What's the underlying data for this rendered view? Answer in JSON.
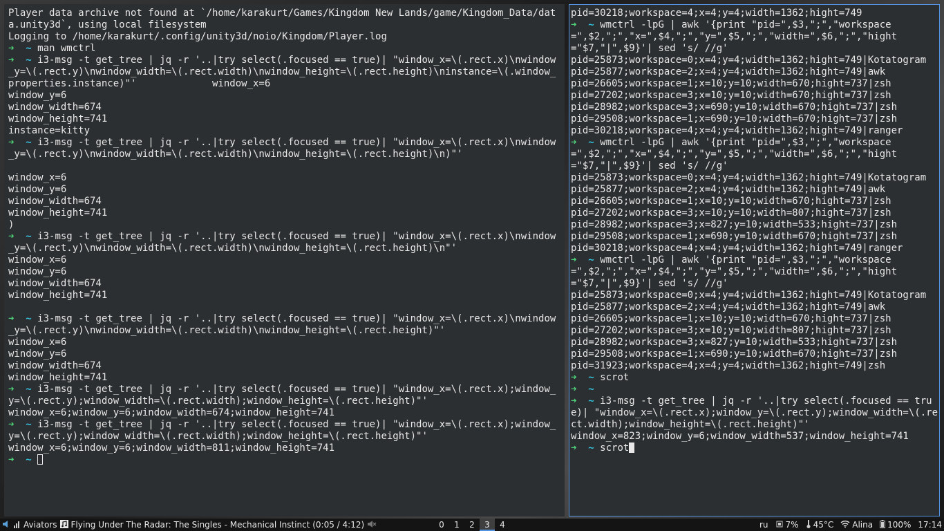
{
  "left_terminal": {
    "lines": [
      {
        "t": "Player data archive not found at `/home/karakurt/Games/Kingdom New Lands/game/Kingdom_Data/data.unity3d`, using local filesystem"
      },
      {
        "t": "Logging to /home/karakurt/.config/unity3d/noio/Kingdom/Player.log"
      },
      {
        "prompt": true,
        "t": "man wmctrl"
      },
      {
        "prompt": true,
        "t": "i3-msg -t get_tree | jq -r '..|try select(.focused == true)| \"window_x=\\(.rect.x)\\nwindow_y=\\(.rect.y)\\nwindow_width=\\(.rect.width)\\nwindow_height=\\(.rect.height)\\ninstance=\\(.window_properties.instance)\"'             window_x=6"
      },
      {
        "t": "window_y=6"
      },
      {
        "t": "window_width=674"
      },
      {
        "t": "window_height=741"
      },
      {
        "t": "instance=kitty"
      },
      {
        "prompt": true,
        "t": "i3-msg -t get_tree | jq -r '..|try select(.focused == true)| \"window_x=\\(.rect.x)\\nwindow_y=\\(.rect.y)\\nwindow_width=\\(.rect.width)\\nwindow_height=\\(.rect.height)\\n)\"'"
      },
      {
        "t": ""
      },
      {
        "t": "window_x=6"
      },
      {
        "t": "window_y=6"
      },
      {
        "t": "window_width=674"
      },
      {
        "t": "window_height=741"
      },
      {
        "t": ")"
      },
      {
        "prompt": true,
        "t": "i3-msg -t get_tree | jq -r '..|try select(.focused == true)| \"window_x=\\(.rect.x)\\nwindow_y=\\(.rect.y)\\nwindow_width=\\(.rect.width)\\nwindow_height=\\(.rect.height)\\n\"'"
      },
      {
        "t": "window_x=6"
      },
      {
        "t": "window_y=6"
      },
      {
        "t": "window_width=674"
      },
      {
        "t": "window_height=741"
      },
      {
        "t": ""
      },
      {
        "prompt": true,
        "t": "i3-msg -t get_tree | jq -r '..|try select(.focused == true)| \"window_x=\\(.rect.x)\\nwindow_y=\\(.rect.y)\\nwindow_width=\\(.rect.width)\\nwindow_height=\\(.rect.height)\"'"
      },
      {
        "t": "window_x=6"
      },
      {
        "t": "window_y=6"
      },
      {
        "t": "window_width=674"
      },
      {
        "t": "window_height=741"
      },
      {
        "prompt": true,
        "t": "i3-msg -t get_tree | jq -r '..|try select(.focused == true)| \"window_x=\\(.rect.x);window_y=\\(.rect.y);window_width=\\(.rect.width);window_height=\\(.rect.height)\"'"
      },
      {
        "t": "window_x=6;window_y=6;window_width=674;window_height=741"
      },
      {
        "prompt": true,
        "t": "i3-msg -t get_tree | jq -r '..|try select(.focused == true)| \"window_x=\\(.rect.x);window_y=\\(.rect.y);window_width=\\(.rect.width);window_height=\\(.rect.height)\"'"
      },
      {
        "t": "window_x=6;window_y=6;window_width=811;window_height=741"
      },
      {
        "prompt": true,
        "t": "",
        "cursor": "hollow"
      }
    ]
  },
  "right_terminal": {
    "lines": [
      {
        "t": "pid=30218;workspace=4;x=4;y=4;width=1362;hight=749"
      },
      {
        "prompt": true,
        "t": "wmctrl -lpG | awk '{print \"pid=\",$3,\";\",\"workspace=\",$2,\";\",\"x=\",$4,\";\",\"y=\",$5,\";\",\"width=\",$6,\";\",\"hight=\"$7,\"|\",$9}'| sed 's/ //g'"
      },
      {
        "t": "pid=25873;workspace=0;x=4;y=4;width=1362;hight=749|Kotatogram"
      },
      {
        "t": "pid=25877;workspace=2;x=4;y=4;width=1362;hight=749|awk"
      },
      {
        "t": "pid=26605;workspace=1;x=10;y=10;width=670;hight=737|zsh"
      },
      {
        "t": "pid=27202;workspace=3;x=10;y=10;width=670;hight=737|zsh"
      },
      {
        "t": "pid=28982;workspace=3;x=690;y=10;width=670;hight=737|zsh"
      },
      {
        "t": "pid=29508;workspace=1;x=690;y=10;width=670;hight=737|zsh"
      },
      {
        "t": "pid=30218;workspace=4;x=4;y=4;width=1362;hight=749|ranger"
      },
      {
        "prompt": true,
        "t": "wmctrl -lpG | awk '{print \"pid=\",$3,\";\",\"workspace=\",$2,\";\",\"x=\",$4,\";\",\"y=\",$5,\";\",\"width=\",$6,\";\",\"hight=\"$7,\"|\",$9}'| sed 's/ //g'"
      },
      {
        "t": "pid=25873;workspace=0;x=4;y=4;width=1362;hight=749|Kotatogram"
      },
      {
        "t": "pid=25877;workspace=2;x=4;y=4;width=1362;hight=749|awk"
      },
      {
        "t": "pid=26605;workspace=1;x=10;y=10;width=670;hight=737|zsh"
      },
      {
        "t": "pid=27202;workspace=3;x=10;y=10;width=807;hight=737|zsh"
      },
      {
        "t": "pid=28982;workspace=3;x=827;y=10;width=533;hight=737|zsh"
      },
      {
        "t": "pid=29508;workspace=1;x=690;y=10;width=670;hight=737|zsh"
      },
      {
        "t": "pid=30218;workspace=4;x=4;y=4;width=1362;hight=749|ranger"
      },
      {
        "prompt": true,
        "t": "wmctrl -lpG | awk '{print \"pid=\",$3,\";\",\"workspace=\",$2,\";\",\"x=\",$4,\";\",\"y=\",$5,\";\",\"width=\",$6,\";\",\"hight=\"$7,\"|\",$9}'| sed 's/ //g'"
      },
      {
        "t": "pid=25873;workspace=0;x=4;y=4;width=1362;hight=749|Kotatogram"
      },
      {
        "t": "pid=25877;workspace=2;x=4;y=4;width=1362;hight=749|awk"
      },
      {
        "t": "pid=26605;workspace=1;x=10;y=10;width=670;hight=737|zsh"
      },
      {
        "t": "pid=27202;workspace=3;x=10;y=10;width=807;hight=737|zsh"
      },
      {
        "t": "pid=28982;workspace=3;x=827;y=10;width=533;hight=737|zsh"
      },
      {
        "t": "pid=29508;workspace=1;x=690;y=10;width=670;hight=737|zsh"
      },
      {
        "t": "pid=31923;workspace=4;x=4;y=4;width=1362;hight=749|zsh"
      },
      {
        "prompt": true,
        "t": "scrot"
      },
      {
        "prompt": true,
        "t": ""
      },
      {
        "prompt": true,
        "t": "i3-msg -t get_tree | jq -r '..|try select(.focused == true)| \"window_x=\\(.rect.x);window_y=\\(.rect.y);window_width=\\(.rect.width);window_height=\\(.rect.height)\"'"
      },
      {
        "t": "window_x=823;window_y=6;window_width=537;window_height=741"
      },
      {
        "prompt": true,
        "t": "scrot",
        "cursor": "solid"
      }
    ]
  },
  "prompt": {
    "arrow": "➜",
    "dir": "~"
  },
  "statusbar": {
    "volume_label": "Aviators",
    "now_playing": "Flying Under The Radar: The Singles - Mechanical Instinct (0:05 / 4:12)",
    "workspaces": [
      {
        "label": "0",
        "active": false
      },
      {
        "label": "1",
        "active": false
      },
      {
        "label": "2",
        "active": false
      },
      {
        "label": "3",
        "active": true
      },
      {
        "label": "4",
        "active": false
      }
    ],
    "keyboard_layout": "ru",
    "cpu": "7%",
    "temperature": "45°C",
    "wifi_name": "Alina",
    "battery": "100%",
    "clock": "17:14"
  },
  "colors": {
    "accent": "#5294e2",
    "prompt_arrow": "#4fd37a",
    "prompt_dir": "#35c5e0",
    "terminal_bg": "#2c2f31"
  },
  "icons": [
    "speaker-icon",
    "signal-bars-icon",
    "music-note-icon",
    "mute-icon",
    "cpu-icon",
    "thermometer-icon",
    "wifi-icon",
    "battery-icon"
  ]
}
